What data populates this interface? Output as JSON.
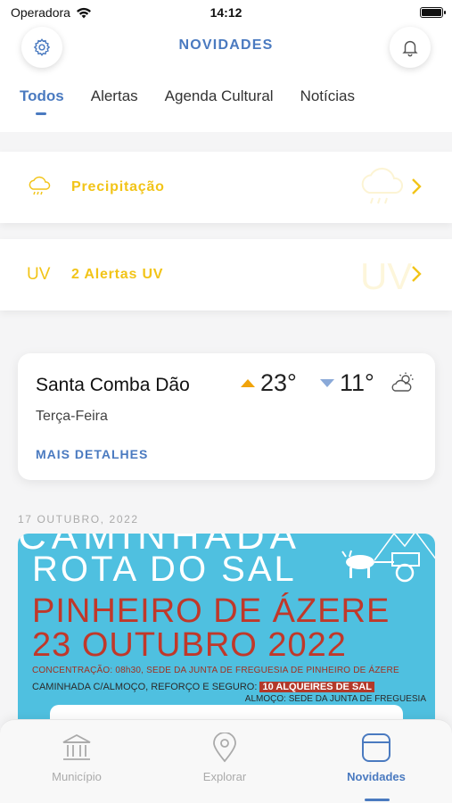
{
  "status_bar": {
    "carrier": "Operadora",
    "time": "14:12",
    "battery_level": 1.0,
    "icons": [
      "wifi-icon",
      "battery-icon"
    ]
  },
  "header": {
    "title": "NOVIDADES",
    "left_icon": "gear-icon",
    "right_icon": "bell-icon"
  },
  "tabs": [
    {
      "label": "Todos",
      "active": true
    },
    {
      "label": "Alertas",
      "active": false
    },
    {
      "label": "Agenda Cultural",
      "active": false
    },
    {
      "label": "Notícias",
      "active": false
    }
  ],
  "alerts": [
    {
      "icon": "rain-cloud-icon",
      "label": "Precipitação"
    },
    {
      "icon_text": "UV",
      "label": "2 Alertas UV",
      "watermark": "UV"
    }
  ],
  "weather": {
    "city": "Santa Comba Dão",
    "day": "Terça-Feira",
    "temp_max": "23°",
    "temp_min": "11°",
    "icon": "partly-cloudy-icon",
    "link": "MAIS DETALHES"
  },
  "feed": {
    "date": "17 OUTUBRO, 2022",
    "poster": {
      "top_text": "CAMINHADA",
      "title": "ROTA DO SAL",
      "line1": "PINHEIRO DE ÁZERE",
      "line2": "23 OUTUBRO 2022",
      "concentration": "CONCENTRAÇÃO: 08h30, SEDE DA JUNTA DE FREGUESIA DE PINHEIRO DE ÁZERE",
      "walk": "CAMINHADA C/ALMOÇO, REFORÇO E SEGURO:",
      "price": "10 ALQUEIRES DE SAL",
      "lunch": "ALMOÇO: SEDE DA JUNTA DE FREGUESIA"
    }
  },
  "bottom_nav": [
    {
      "label": "Município",
      "icon": "building-icon",
      "active": false
    },
    {
      "label": "Explorar",
      "icon": "location-pin-icon",
      "active": false
    },
    {
      "label": "Novidades",
      "icon": "news-card-icon",
      "active": true
    }
  ],
  "colors": {
    "accent": "#4a7ac0",
    "alert": "#f2c418",
    "temp_up": "#f0a30a",
    "temp_down": "#8aa9d8",
    "poster_bg": "#4fc0e0",
    "poster_red": "#c0382a"
  }
}
